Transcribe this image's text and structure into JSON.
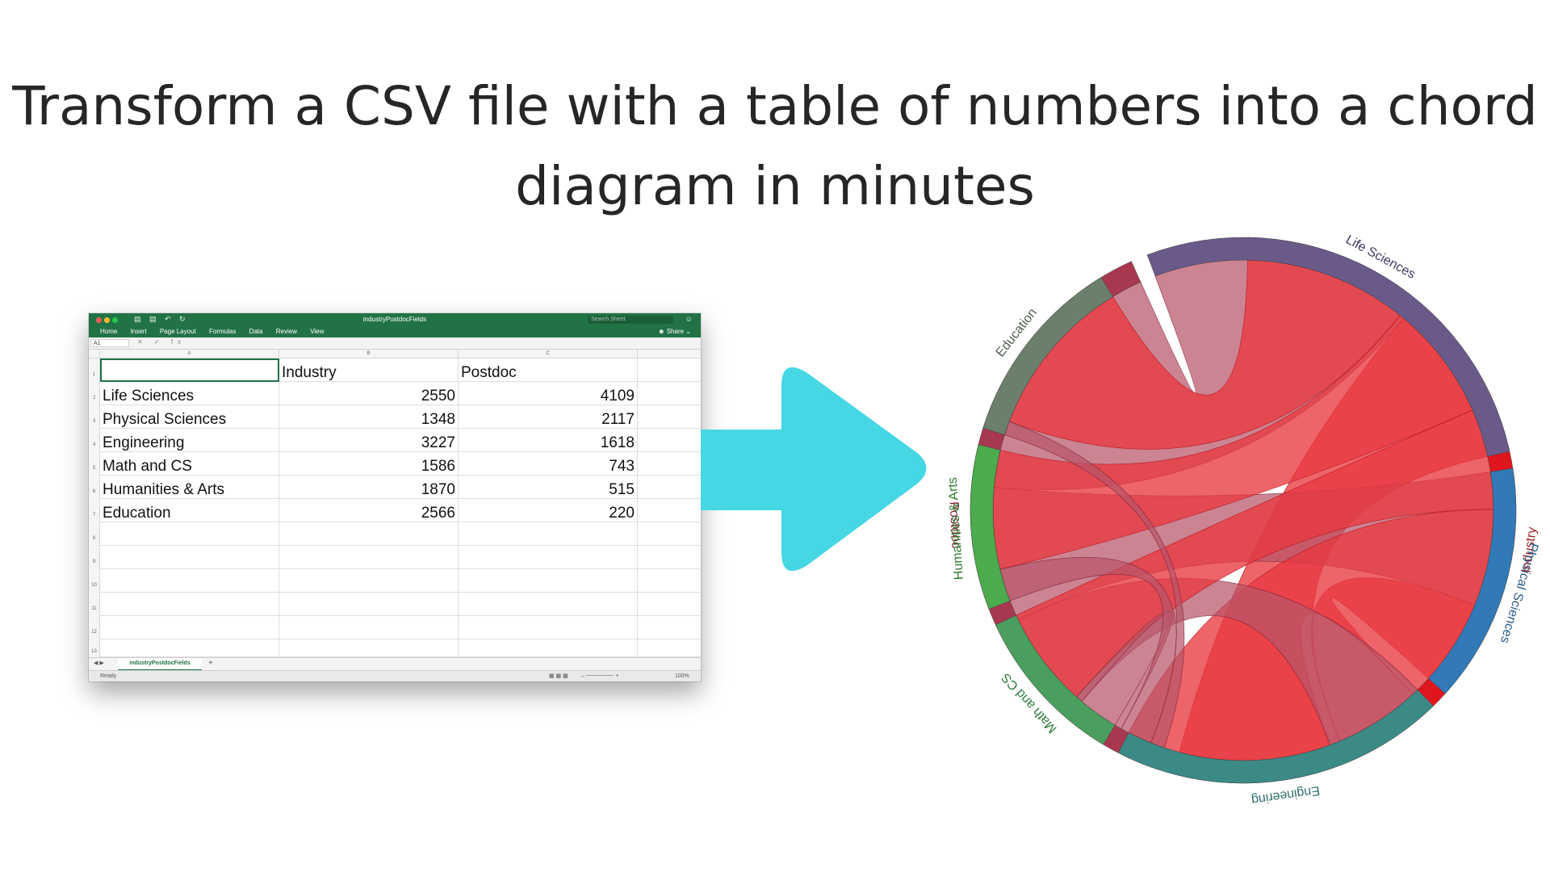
{
  "headline": {
    "line1": "Transform a CSV file with a table of numbers into a chord",
    "line2": "diagram in minutes"
  },
  "excel": {
    "window_title": "industryPostdocFields",
    "search_placeholder": "Search Sheet",
    "ribbon_tabs": [
      "Home",
      "Insert",
      "Page Layout",
      "Formulas",
      "Data",
      "Review",
      "View"
    ],
    "share_label": "Share",
    "name_box": "A1",
    "fx_label": "fx",
    "column_letters": [
      "A",
      "B",
      "C"
    ],
    "row_numbers": [
      "1",
      "2",
      "3",
      "4",
      "5",
      "6",
      "7",
      "8",
      "9",
      "10",
      "11",
      "12",
      "13"
    ],
    "header_row": [
      "",
      "Industry",
      "Postdoc"
    ],
    "rows": [
      [
        "Life Sciences",
        "2550",
        "4109"
      ],
      [
        "Physical Sciences",
        "1348",
        "2117"
      ],
      [
        "Engineering",
        "3227",
        "1618"
      ],
      [
        "Math and CS",
        "1586",
        "743"
      ],
      [
        "Humanities & Arts",
        "1870",
        "515"
      ],
      [
        "Education",
        "2566",
        "220"
      ]
    ],
    "sheet_tab": "industryPostdocFields",
    "status": "Ready",
    "zoom": "100%"
  },
  "arrow_color": "#45D7E3",
  "chart_data": {
    "type": "chord",
    "sources": [
      "Life Sciences",
      "Physical Sciences",
      "Engineering",
      "Math and CS",
      "Humanities & Arts",
      "Education"
    ],
    "targets": [
      "Industry",
      "Postdoc"
    ],
    "matrix": [
      [
        2550,
        4109
      ],
      [
        1348,
        2117
      ],
      [
        3227,
        1618
      ],
      [
        1586,
        743
      ],
      [
        1870,
        515
      ],
      [
        2566,
        220
      ]
    ],
    "group_labels": [
      "Industry",
      "Postdoc",
      "Life Sciences",
      "Physical Sciences",
      "Engineering",
      "Math and CS",
      "Humanities & Arts",
      "Education"
    ],
    "group_colors": {
      "Industry": "#E0161E",
      "Postdoc": "#A8384F",
      "Life Sciences": "#6A5A8A",
      "Physical Sciences": "#3279B7",
      "Engineering": "#3B8A86",
      "Math and CS": "#4A9E5E",
      "Humanities & Arts": "#4CAB4D",
      "Education": "#6C7F6C"
    },
    "label_colors": {
      "Industry": "#9B1B1B",
      "Postdoc": "#8C2236",
      "Life Sciences": "#3E3A5E",
      "Physical Sciences": "#2C5D8A",
      "Engineering": "#2E6E6A",
      "Math and CS": "#2E7A3C",
      "Humanities & Arts": "#2E7A2E",
      "Education": "#4D5E4D"
    },
    "ribbon_colors": {
      "Industry": "#E8383F",
      "Postdoc": "#B85569"
    }
  }
}
